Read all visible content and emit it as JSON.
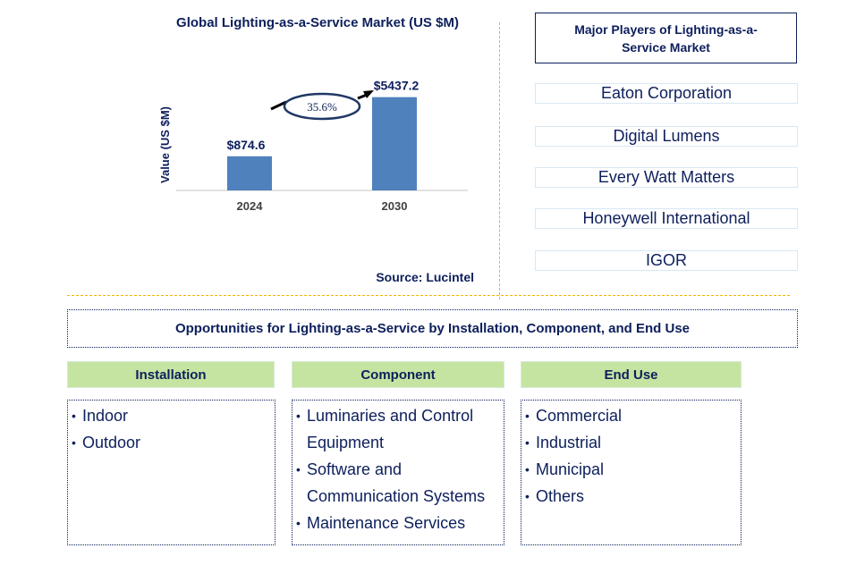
{
  "chart_data": {
    "type": "bar",
    "title": "Global Lighting-as-a-Service Market (US $M)",
    "xlabel": "",
    "ylabel": "Value (US $M)",
    "categories": [
      "2024",
      "2030"
    ],
    "values": [
      874.6,
      5437.2
    ],
    "data_labels": [
      "$874.6",
      "$5437.2"
    ],
    "ylim": [
      0,
      6000
    ],
    "grid": false,
    "bar_color": "#4f81bd",
    "annotation": {
      "type": "cagr-arrow",
      "label": "35.6%"
    },
    "source": "Source: Lucintel"
  },
  "players": {
    "title": "Major Players of Lighting-as-a-Service Market",
    "items": [
      "Eaton Corporation",
      "Digital Lumens",
      "Every Watt Matters",
      "Honeywell International",
      "IGOR"
    ]
  },
  "opportunities": {
    "title": "Opportunities for Lighting-as-a-Service by Installation, Component, and End Use",
    "categories": [
      {
        "label": "Installation",
        "items": [
          "Indoor",
          "Outdoor"
        ]
      },
      {
        "label": "Component",
        "items": [
          "Luminaries and Control Equipment",
          "Software and Communication Systems",
          "Maintenance Services"
        ]
      },
      {
        "label": "End Use",
        "items": [
          "Commercial",
          "Industrial",
          "Municipal",
          "Others"
        ]
      }
    ]
  },
  "colors": {
    "text": "#0d1f5c",
    "bar": "#4f81bd",
    "category_header": "#c6e4a1",
    "separator": "#f0b400"
  }
}
